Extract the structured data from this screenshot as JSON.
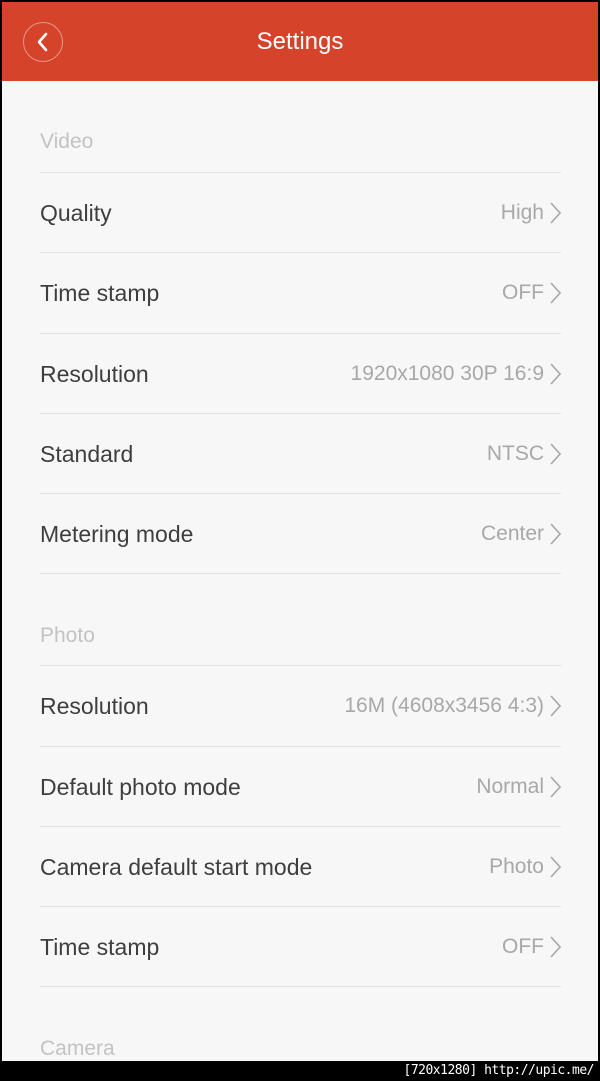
{
  "header": {
    "title": "Settings",
    "back_icon": "chevron-left-icon",
    "color": "#d4432a"
  },
  "sections": [
    {
      "label": "Video",
      "rows": [
        {
          "label": "Quality",
          "value": "High"
        },
        {
          "label": "Time stamp",
          "value": "OFF"
        },
        {
          "label": "Resolution",
          "value": "1920x1080 30P 16:9"
        },
        {
          "label": "Standard",
          "value": "NTSC"
        },
        {
          "label": "Metering mode",
          "value": "Center"
        }
      ]
    },
    {
      "label": "Photo",
      "rows": [
        {
          "label": "Resolution",
          "value": "16M (4608x3456 4:3)"
        },
        {
          "label": "Default photo mode",
          "value": "Normal"
        },
        {
          "label": "Camera default start mode",
          "value": "Photo"
        },
        {
          "label": "Time stamp",
          "value": "OFF"
        }
      ]
    },
    {
      "label": "Camera",
      "rows": []
    }
  ],
  "watermark": "[720x1280] http://upic.me/"
}
